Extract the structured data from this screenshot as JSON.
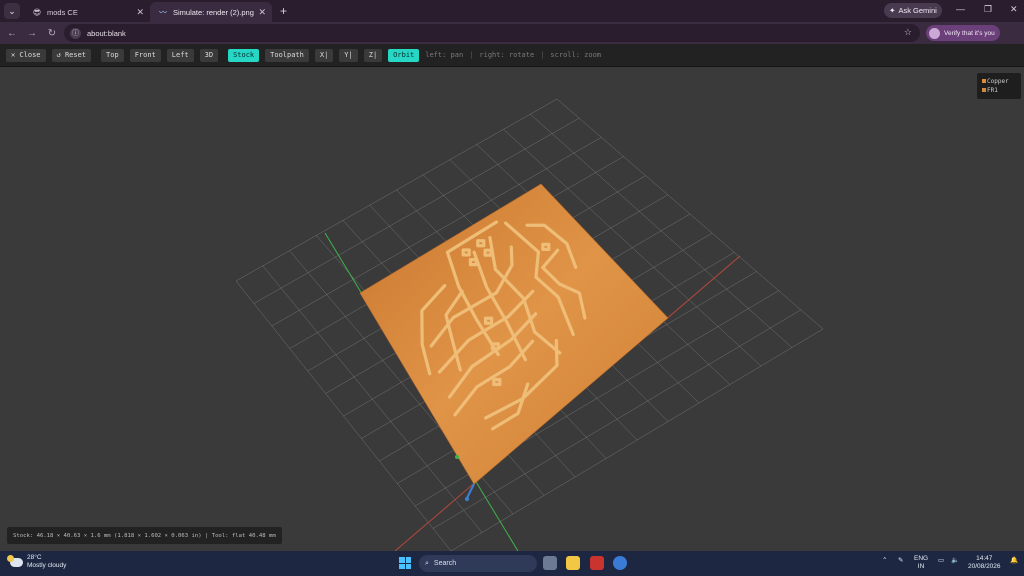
{
  "browser": {
    "tabs": [
      {
        "title": "mods CE",
        "favicon": "smiley-icon"
      },
      {
        "title": "Simulate: render (2).png",
        "favicon": "activity-icon"
      }
    ],
    "ask_label": "Ask Gemini",
    "address": "about:blank",
    "verify_label": "Verify that it's you"
  },
  "toolbar": {
    "close_label": "✕ Close",
    "reset_label": "↺ Reset",
    "views": [
      "Top",
      "Front",
      "Left",
      "3D"
    ],
    "stock_label": "Stock",
    "toolpath_label": "Toolpath",
    "axis_buttons": [
      "X|",
      "Y|",
      "Z|"
    ],
    "orbit_label": "Orbit",
    "hints": [
      "left: pan",
      "right: rotate",
      "scroll: zoom"
    ],
    "hint_separator": "|"
  },
  "legend": {
    "items": [
      {
        "label": "Copper",
        "color": "#e08a3a"
      },
      {
        "label": "FR1",
        "color": "#d48a3c"
      }
    ]
  },
  "status_text": "Stock: 46.18 × 40.63 × 1.6 mm (1.818 × 1.602 × 0.063 in) | Tool: flat 40.48 mm",
  "colors": {
    "accent_active": "#27d7c6",
    "board": "#d4883f",
    "axis_x": "#b5483c",
    "axis_y": "#3fb34a",
    "axis_z": "#3d7fd6",
    "grid": "#8a8a8a"
  },
  "taskbar": {
    "weather_temp": "28°C",
    "weather_desc": "Mostly cloudy",
    "search_label": "Search",
    "lang_1": "ENG",
    "lang_2": "IN",
    "time": "14:47",
    "date": "20/08/2026"
  }
}
